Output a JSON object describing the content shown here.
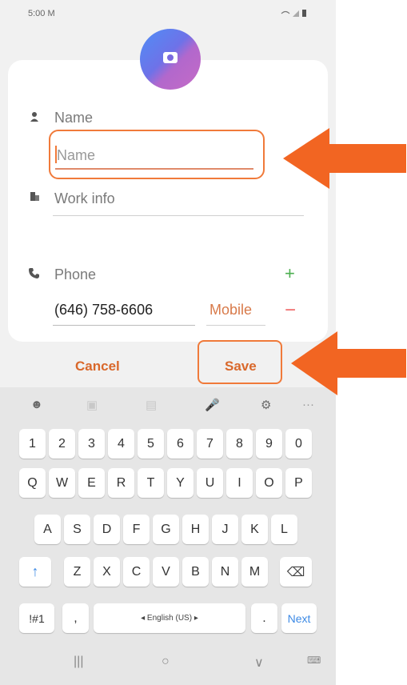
{
  "status_bar": {
    "time": "5:00",
    "notif_icon": "M",
    "right_icons": "WiFi signal battery"
  },
  "form": {
    "name_label": "Name",
    "name_placeholder": "Name",
    "work_info_label": "Work info",
    "phone_label": "Phone",
    "phone_value": "(646) 758-6606",
    "phone_type": "Mobile",
    "add_symbol": "+",
    "remove_symbol": "−"
  },
  "actions": {
    "cancel": "Cancel",
    "save": "Save"
  },
  "keyboard": {
    "toolbar": [
      "☻",
      "▣",
      "▤",
      "🎤",
      "⚙",
      "···"
    ],
    "row_numbers": [
      "1",
      "2",
      "3",
      "4",
      "5",
      "6",
      "7",
      "8",
      "9",
      "0"
    ],
    "row_1": [
      "Q",
      "W",
      "E",
      "R",
      "T",
      "Y",
      "U",
      "I",
      "O",
      "P"
    ],
    "row_2": [
      "A",
      "S",
      "D",
      "F",
      "G",
      "H",
      "J",
      "K",
      "L"
    ],
    "row_3": [
      "Z",
      "X",
      "C",
      "V",
      "B",
      "N",
      "M"
    ],
    "symbols_key": "!#1",
    "comma_key": ",",
    "space_label": "◂ English (US) ▸",
    "period_key": ".",
    "next_key": "Next",
    "shift_symbol": "↑",
    "backspace_symbol": "⌫"
  },
  "navbar": {
    "recent": "|||",
    "home": "○",
    "back": "∨",
    "keyboard": "⌨"
  },
  "colors": {
    "accent": "#f07a3a",
    "arrow": "#f26522",
    "save_text": "#d9682b",
    "add_green": "#4caf50",
    "remove_red": "#f06b6b"
  }
}
